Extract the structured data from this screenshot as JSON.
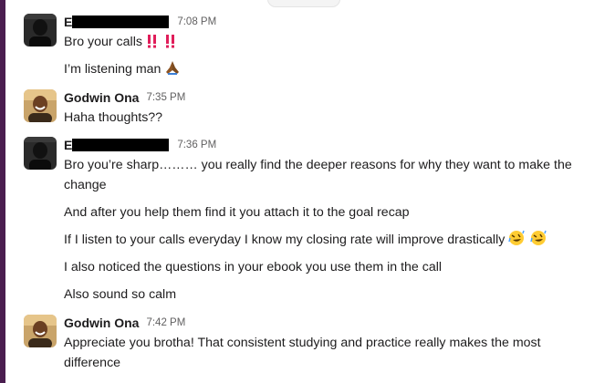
{
  "messages": [
    {
      "sender_visible": "E",
      "time": "7:08 PM",
      "lines": [
        "Bro your calls",
        "I’m listening man"
      ]
    },
    {
      "sender_visible": "Godwin Ona",
      "time": "7:35 PM",
      "lines": [
        "Haha thoughts??"
      ]
    },
    {
      "sender_visible": "E",
      "time": "7:36 PM",
      "lines": [
        "Bro you’re sharp……… you really find the deeper reasons for why they want to make the change",
        "And after you help them find it you attach it to the goal recap",
        "If I listen to your calls everyday I know my closing rate will improve drastically",
        "I also noticed the questions in your ebook you use them in the call",
        "Also sound so calm"
      ]
    },
    {
      "sender_visible": "Godwin Ona",
      "time": "7:42 PM",
      "lines": [
        "Appreciate you brotha! That consistent studying and practice really makes the most difference"
      ]
    }
  ],
  "emojis": {
    "double_exclamation": "double-exclamation-icon",
    "pray": "folded-hands-icon",
    "laugh": "rolling-on-floor-laughing-icon"
  },
  "colors": {
    "sidebar": "#4a1d4f",
    "text": "#1d1c1d",
    "timestamp": "#616061",
    "exclamation": "#e01e5a"
  }
}
